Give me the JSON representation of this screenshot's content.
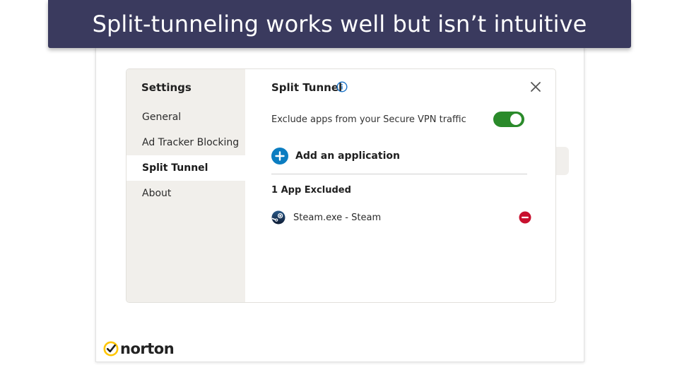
{
  "banner": {
    "title": "Split-tunneling works well but isn’t intuitive"
  },
  "sidebar": {
    "title": "Settings",
    "items": [
      {
        "label": "General",
        "active": false
      },
      {
        "label": "Ad Tracker Blocking",
        "active": false
      },
      {
        "label": "Split Tunnel",
        "active": true
      },
      {
        "label": "About",
        "active": false
      }
    ]
  },
  "panel": {
    "title": "Split Tunnel",
    "toggle_label": "Exclude apps from your Secure VPN traffic",
    "toggle_on": true,
    "add_label": "Add an application",
    "excluded_heading": "1 App Excluded",
    "apps": [
      {
        "name": "Steam.exe - Steam",
        "icon": "steam-icon"
      }
    ]
  },
  "brand": {
    "name": "norton"
  },
  "colors": {
    "banner_bg": "#3a3a5e",
    "toggle_on": "#2a8a2a",
    "add_button": "#0b7dc1",
    "remove_button": "#c8102e",
    "info_icon": "#1a73c8",
    "norton_yellow": "#ffc600"
  }
}
